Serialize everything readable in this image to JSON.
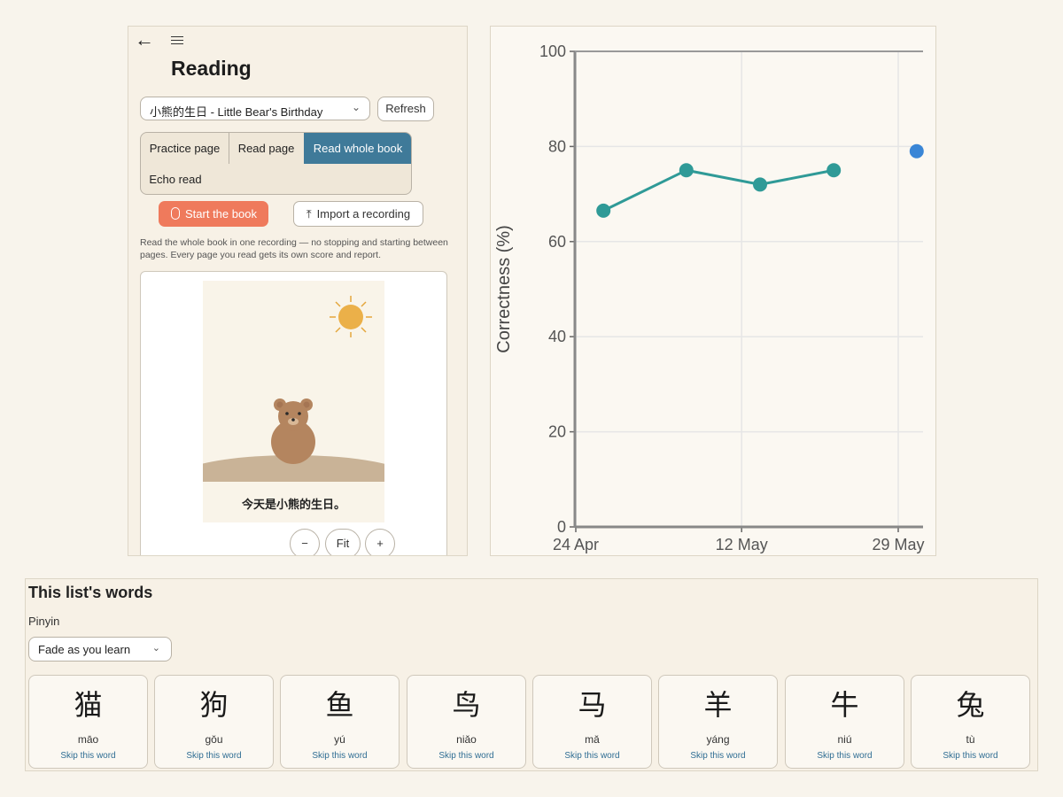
{
  "reader": {
    "title": "Reading",
    "book_select": "小熊的生日 - Little Bear's Birthday",
    "refresh_label": "Refresh",
    "tabs": [
      {
        "label": "Practice page",
        "selected": false
      },
      {
        "label": "Read page",
        "selected": false
      },
      {
        "label": "Read whole book",
        "selected": true
      },
      {
        "label": "Echo read",
        "selected": false
      }
    ],
    "start_label": "Start the book",
    "import_label": "Import a recording",
    "description": "Read the whole book in one recording — no stopping and starting between pages. Every page you read gets its own score and report.",
    "page_caption": "今天是小熊的生日。",
    "zoom_out": "−",
    "zoom_fit": "Fit",
    "zoom_in": "+"
  },
  "chart_data": {
    "type": "line",
    "ylabel": "Correctness (%)",
    "ylim": [
      0,
      100
    ],
    "yticks": [
      0,
      20,
      40,
      60,
      80,
      100
    ],
    "xticks": [
      "24 Apr",
      "12 May",
      "29 May"
    ],
    "grid": true,
    "series": [
      {
        "color": "#2f9a97",
        "points": [
          {
            "x": "2024-04-27",
            "y": 66.5
          },
          {
            "x": "2024-05-06",
            "y": 75
          },
          {
            "x": "2024-05-14",
            "y": 72
          },
          {
            "x": "2024-05-22",
            "y": 75
          }
        ]
      },
      {
        "color": "#3a86d6",
        "points": [
          {
            "x": "2024-05-31",
            "y": 79
          }
        ]
      }
    ]
  },
  "words": {
    "title": "This list's words",
    "pinyin_label": "Pinyin",
    "pinyin_mode": "Fade as you learn",
    "skip_label": "Skip this word",
    "items": [
      {
        "hanzi": "猫",
        "pinyin": "māo"
      },
      {
        "hanzi": "狗",
        "pinyin": "gǒu"
      },
      {
        "hanzi": "鱼",
        "pinyin": "yú"
      },
      {
        "hanzi": "鸟",
        "pinyin": "niǎo"
      },
      {
        "hanzi": "马",
        "pinyin": "mǎ"
      },
      {
        "hanzi": "羊",
        "pinyin": "yáng"
      },
      {
        "hanzi": "牛",
        "pinyin": "niú"
      },
      {
        "hanzi": "兔",
        "pinyin": "tù"
      }
    ]
  },
  "colors": {
    "accent": "#3f7a99",
    "start_button": "#ef7a5c",
    "series_teal": "#2f9a97",
    "series_blue": "#3a86d6"
  }
}
